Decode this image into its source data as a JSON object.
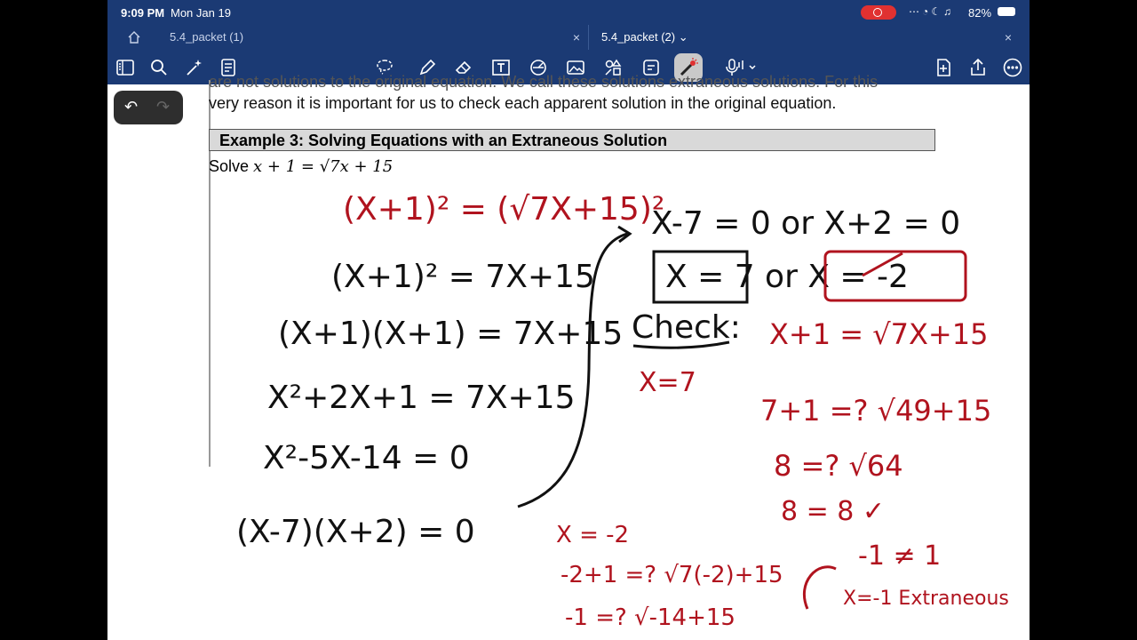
{
  "status_bar": {
    "time": "9:09 PM",
    "date": "Mon Jan 19",
    "battery": "82%"
  },
  "tabs": [
    {
      "label": "5.4_packet (1)"
    },
    {
      "label": "5.4_packet (2)"
    }
  ],
  "toolbar_icons": [
    "sidebar-icon",
    "search-icon",
    "magic-icon",
    "document-icon",
    "lasso-icon",
    "pen-icon",
    "eraser-icon",
    "text-box-icon",
    "shapes-icon",
    "image-icon",
    "elements-icon",
    "sticker-icon",
    "laser-pointer-icon",
    "microphone-icon",
    "add-page-icon",
    "share-icon",
    "more-icon"
  ],
  "document": {
    "clipped_line": "are not solutions to the original equation. We call these solutions extraneous solutions. For this",
    "paragraph": "very reason it is important for us to check each apparent solution in the original equation.",
    "example_title": "Example 3: Solving Equations with an Extraneous Solution",
    "solve_prefix": "Solve",
    "solve_equation": "x + 1 = √7x + 15"
  },
  "handwriting": {
    "colors": {
      "black": "#111111",
      "red": "#b0131e"
    },
    "left_steps": [
      "(X+1)² = (√7X+15)²",
      "(X+1)² = 7X+15",
      "(X+1)(X+1) = 7X+15",
      "X²+2X+1 = 7X+15",
      "X²-5X-14 = 0",
      "(X-7)(X+2) = 0"
    ],
    "right_top": "X-7 = 0  or  X+2 = 0",
    "roots": "X = 7  or  X = -2",
    "check_label": "Check:",
    "check_x": "X=7",
    "check_equation": "X+1 = √7X+15",
    "check_7": [
      "7+1 =? √49+15",
      "8 =? √64",
      "8 = 8 ✓"
    ],
    "check_neg2": [
      "X = -2",
      "-2+1 =? √7(-2)+15",
      "-1 =? √-14+15"
    ],
    "result": "-1 ≠ 1",
    "conclusion": "X=-1 Extraneous"
  }
}
